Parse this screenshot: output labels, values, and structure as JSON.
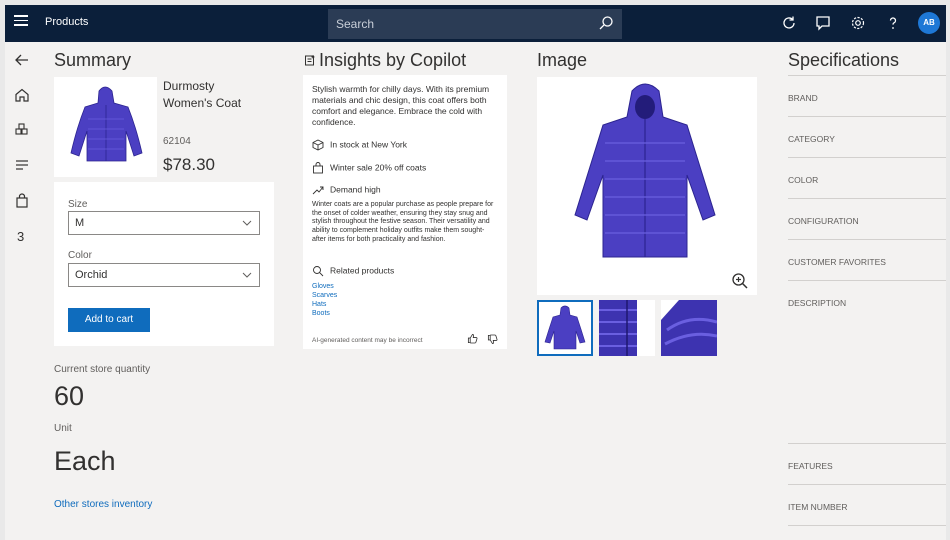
{
  "header": {
    "app_title": "Products",
    "search_placeholder": "Search",
    "avatar_initials": "AB"
  },
  "rail": {
    "count_badge": "3"
  },
  "summary": {
    "title": "Summary",
    "product_name": "Durmosty Women's Coat",
    "product_number": "62104",
    "price": "$78.30",
    "size_label": "Size",
    "size_value": "M",
    "color_label": "Color",
    "color_value": "Orchid",
    "add_to_cart": "Add to cart",
    "store_qty_label": "Current store quantity",
    "store_qty_value": "60",
    "unit_label": "Unit",
    "unit_value": "Each",
    "other_stores_link": "Other stores inventory"
  },
  "insights": {
    "title": "Insights by Copilot",
    "intro": "Stylish warmth for chilly days. With its premium materials and chic design, this coat offers both comfort and elegance. Embrace the cold with confidence.",
    "stock": "In stock at New York",
    "sale": "Winter sale 20% off coats",
    "demand_title": "Demand high",
    "demand_text": "Winter coats are a popular purchase as people prepare for the onset of colder weather, ensuring they stay snug and stylish throughout the festive season. Their versatility and ability to complement holiday outfits make them sought-after items for both practicality and fashion.",
    "related_title": "Related products",
    "related_items": [
      "Gloves",
      "Scarves",
      "Hats",
      "Boots"
    ],
    "disclaimer": "AI-generated content may be incorrect"
  },
  "image_section": {
    "title": "Image"
  },
  "specifications": {
    "title": "Specifications",
    "fields": [
      "BRAND",
      "CATEGORY",
      "COLOR",
      "CONFIGURATION",
      "CUSTOMER FAVORITES",
      "DESCRIPTION",
      "FEATURES",
      "ITEM NUMBER"
    ]
  },
  "colors": {
    "topbar": "#0b1f3a",
    "accent": "#0f6cbd",
    "coat": "#4b3fc2"
  },
  "icons": [
    "hamburger-icon",
    "search-icon",
    "refresh-icon",
    "chat-icon",
    "gear-icon",
    "help-icon",
    "back-arrow-icon",
    "home-icon",
    "products-icon",
    "list-icon",
    "bag-icon",
    "copilot-icon",
    "package-icon",
    "sale-tag-icon",
    "trend-icon",
    "related-icon",
    "thumbs-up-icon",
    "thumbs-down-icon",
    "zoom-in-icon",
    "chevron-down-icon"
  ]
}
